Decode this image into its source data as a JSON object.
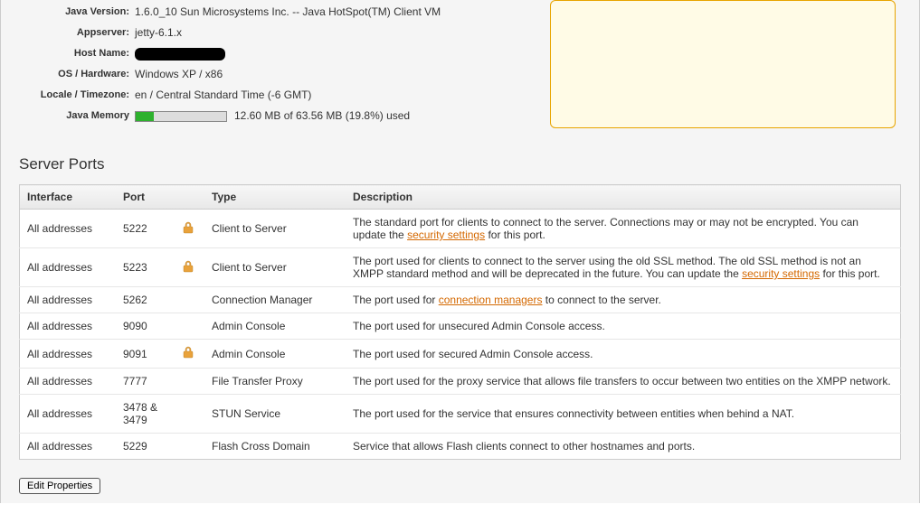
{
  "info": {
    "java_version": {
      "label": "Java Version:",
      "value": "1.6.0_10 Sun Microsystems Inc. -- Java HotSpot(TM) Client VM"
    },
    "appserver": {
      "label": "Appserver:",
      "value": "jetty-6.1.x"
    },
    "host_name": {
      "label": "Host Name:",
      "value": ""
    },
    "os_hardware": {
      "label": "OS / Hardware:",
      "value": "Windows XP / x86"
    },
    "locale": {
      "label": "Locale / Timezone:",
      "value": "en / Central Standard Time (-6 GMT)"
    },
    "memory": {
      "label": "Java Memory",
      "value": "12.60 MB of 63.56 MB (19.8%) used",
      "percent": 19.8
    }
  },
  "section_title": "Server Ports",
  "table": {
    "headers": {
      "interface": "Interface",
      "port": "Port",
      "type": "Type",
      "description": "Description"
    },
    "rows": [
      {
        "interface": "All addresses",
        "port": "5222",
        "lock": true,
        "type": "Client to Server",
        "desc_pre": "The standard port for clients to connect to the server. Connections may or may not be encrypted. You can update the ",
        "link": "security settings",
        "desc_post": " for this port."
      },
      {
        "interface": "All addresses",
        "port": "5223",
        "lock": true,
        "type": "Client to Server",
        "desc_pre": "The port used for clients to connect to the server using the old SSL method. The old SSL method is not an XMPP standard method and will be deprecated in the future. You can update the ",
        "link": "security settings",
        "desc_post": " for this port."
      },
      {
        "interface": "All addresses",
        "port": "5262",
        "lock": false,
        "type": "Connection Manager",
        "desc_pre": "The port used for ",
        "link": "connection managers",
        "desc_post": " to connect to the server."
      },
      {
        "interface": "All addresses",
        "port": "9090",
        "lock": false,
        "type": "Admin Console",
        "desc_pre": "The port used for unsecured Admin Console access.",
        "link": "",
        "desc_post": ""
      },
      {
        "interface": "All addresses",
        "port": "9091",
        "lock": true,
        "type": "Admin Console",
        "desc_pre": "The port used for secured Admin Console access.",
        "link": "",
        "desc_post": ""
      },
      {
        "interface": "All addresses",
        "port": "7777",
        "lock": false,
        "type": "File Transfer Proxy",
        "desc_pre": "The port used for the proxy service that allows file transfers to occur between two entities on the XMPP network.",
        "link": "",
        "desc_post": ""
      },
      {
        "interface": "All addresses",
        "port": "3478 & 3479",
        "lock": false,
        "type": "STUN Service",
        "desc_pre": "The port used for the service that ensures connectivity between entities when behind a NAT.",
        "link": "",
        "desc_post": ""
      },
      {
        "interface": "All addresses",
        "port": "5229",
        "lock": false,
        "type": "Flash Cross Domain",
        "desc_pre": "Service that allows Flash clients connect to other hostnames and ports.",
        "link": "",
        "desc_post": ""
      }
    ]
  },
  "edit_button": "Edit Properties"
}
